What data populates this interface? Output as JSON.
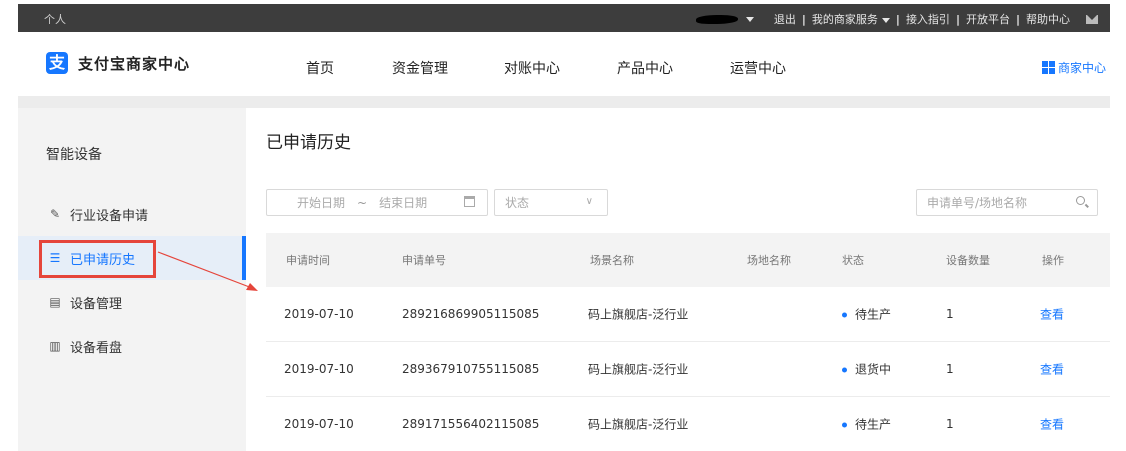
{
  "topbar": {
    "personal": "个人",
    "logout": "退出",
    "services": "我的商家服务",
    "guide": "接入指引",
    "open_platform": "开放平台",
    "help": "帮助中心"
  },
  "header": {
    "logo_char": "支",
    "brand": "支付宝商家中心",
    "nav": [
      "首页",
      "资金管理",
      "对账中心",
      "产品中心",
      "运营中心"
    ],
    "merchant_center": "商家中心"
  },
  "sidebar": {
    "title": "智能设备",
    "items": [
      {
        "label": "行业设备申请",
        "icon": "edit-icon"
      },
      {
        "label": "已申请历史",
        "icon": "list-icon"
      },
      {
        "label": "设备管理",
        "icon": "device-icon"
      },
      {
        "label": "设备看盘",
        "icon": "chart-icon"
      }
    ]
  },
  "main": {
    "title": "已申请历史",
    "filters": {
      "start_date": "开始日期",
      "tilde": "~",
      "end_date": "结束日期",
      "status": "状态",
      "search_placeholder": "申请单号/场地名称"
    },
    "table": {
      "headers": [
        "申请时间",
        "申请单号",
        "场景名称",
        "场地名称",
        "状态",
        "设备数量",
        "操作"
      ],
      "rows": [
        {
          "date": "2019-07-10",
          "order": "289216869905115085",
          "scene": "码上旗舰店-泛行业",
          "venue": "",
          "status": "待生产",
          "count": "1",
          "action": "查看"
        },
        {
          "date": "2019-07-10",
          "order": "289367910755115085",
          "scene": "码上旗舰店-泛行业",
          "venue": "",
          "status": "退货中",
          "count": "1",
          "action": "查看"
        },
        {
          "date": "2019-07-10",
          "order": "289171556402115085",
          "scene": "码上旗舰店-泛行业",
          "venue": "",
          "status": "待生产",
          "count": "1",
          "action": "查看"
        }
      ]
    }
  },
  "colors": {
    "accent": "#1677ff",
    "annotation": "#e5453b",
    "topbar": "#3d3d3d"
  }
}
